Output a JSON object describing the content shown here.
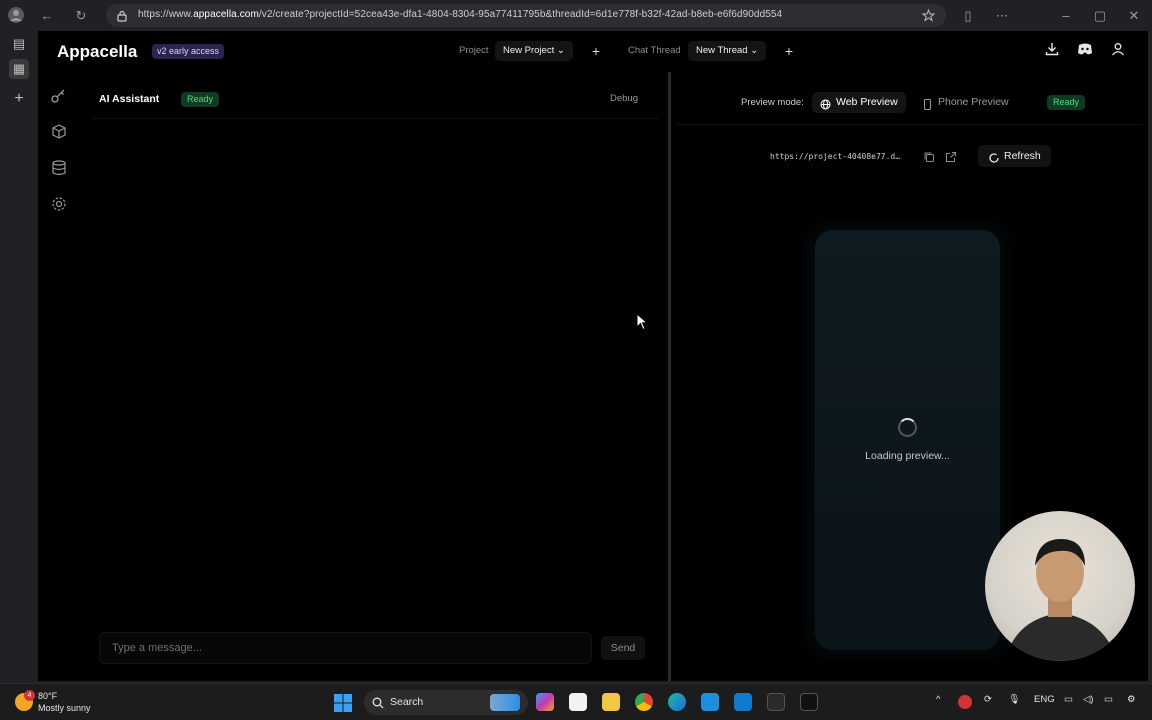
{
  "browser": {
    "url_prefix": "https://www.",
    "url_host": "appacella.com",
    "url_path": "/v2/create?projectId=52cea43e-dfa1-4804-8304-95a77411795b&threadId=6d1e778f-b32f-42ad-b8eb-e6f6d90dd554"
  },
  "app": {
    "logo": "Appacella",
    "badge": "v2 early access",
    "project_label": "Project",
    "project_value": "New Project",
    "thread_label": "Chat Thread",
    "thread_value": "New Thread"
  },
  "chat": {
    "title": "AI Assistant",
    "status": "Ready",
    "debug": "Debug",
    "input_placeholder": "Type a message...",
    "send": "Send"
  },
  "preview": {
    "mode_label": "Preview mode:",
    "web_preview": "Web Preview",
    "phone_preview": "Phone Preview",
    "status": "Ready",
    "url": "https://project-40408e77.d…",
    "refresh": "Refresh",
    "loading": "Loading preview..."
  },
  "taskbar": {
    "temperature": "80°F",
    "weather": "Mostly sunny",
    "search": "Search",
    "language": "ENG",
    "weather_badge": "4"
  },
  "colors": {
    "accent_green": "#4ade80",
    "badge_purple": "#2a2550"
  }
}
